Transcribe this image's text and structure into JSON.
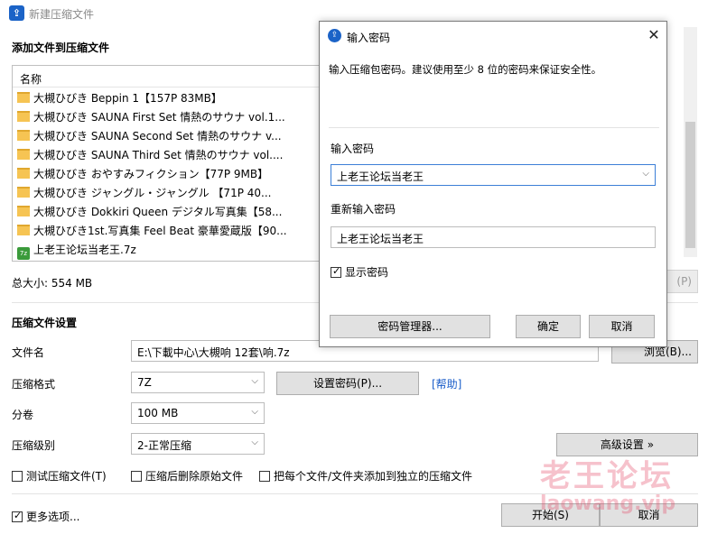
{
  "window": {
    "title": "新建压缩文件"
  },
  "add_section": {
    "title": "添加文件到压缩文件",
    "column_name": "名称",
    "items": [
      {
        "icon": "folder-icon",
        "label": "大槻ひびき  Beppin 1【157P 83MB】"
      },
      {
        "icon": "folder-icon",
        "label": "大槻ひびき  SAUNA First Set 情熱のサウナ vol.1..."
      },
      {
        "icon": "folder-icon",
        "label": "大槻ひびき  SAUNA Second Set 情熱のサウナ v..."
      },
      {
        "icon": "folder-icon",
        "label": "大槻ひびき  SAUNA Third Set 情熱のサウナ vol...."
      },
      {
        "icon": "folder-icon",
        "label": "大槻ひびき  おやすみフィクション【77P 9MB】"
      },
      {
        "icon": "folder-icon",
        "label": "大槻ひびき  ジャングル・ジャングル  【71P 40..."
      },
      {
        "icon": "folder-icon",
        "label": "大槻ひびき Dokkiri Queen デジタル写真集【58..."
      },
      {
        "icon": "folder-icon",
        "label": "大槻ひびき1st.写真集 Feel Beat 豪華愛蔵版【90..."
      },
      {
        "icon": "archive-icon",
        "label": "上老王论坛当老王.7z"
      }
    ],
    "total_size": "总大小: 554 MB",
    "hidden_button": "(P)"
  },
  "settings": {
    "title": "压缩文件设置",
    "filename_label": "文件名",
    "filename_value": "E:\\下載中心\\大槻响 12套\\响.7z",
    "browse_button": "浏览(B)...",
    "format_label": "压缩格式",
    "format_value": "7Z",
    "set_password_button": "设置密码(P)...",
    "help_link": "[帮助]",
    "volume_label": "分卷",
    "volume_value": "100 MB",
    "level_label": "压缩级别",
    "level_value": "2-正常压缩",
    "advanced_button": "高级设置 »",
    "test_checkbox": "测试压缩文件(T)",
    "delete_checkbox": "压缩后删除原始文件",
    "separate_checkbox": "把每个文件/文件夹添加到独立的压缩文件",
    "more_options": "更多选项...",
    "start_button": "开始(S)",
    "cancel_button": "取消"
  },
  "dialog": {
    "title": "输入密码",
    "description": "输入压缩包密码。建议使用至少 8 位的密码来保证安全性。",
    "password_label": "输入密码",
    "password_value": "上老王论坛当老王",
    "repeat_label": "重新输入密码",
    "repeat_value": "上老王论坛当老王",
    "show_password": "显示密码",
    "manager_button": "密码管理器...",
    "ok_button": "确定",
    "cancel_button": "取消"
  },
  "watermark": {
    "main": "老王论坛",
    "sub": "laowang.vip"
  },
  "colors": {
    "accent": "#1b63c7",
    "link": "#1a5dc9",
    "watermark": "#e6506e"
  }
}
